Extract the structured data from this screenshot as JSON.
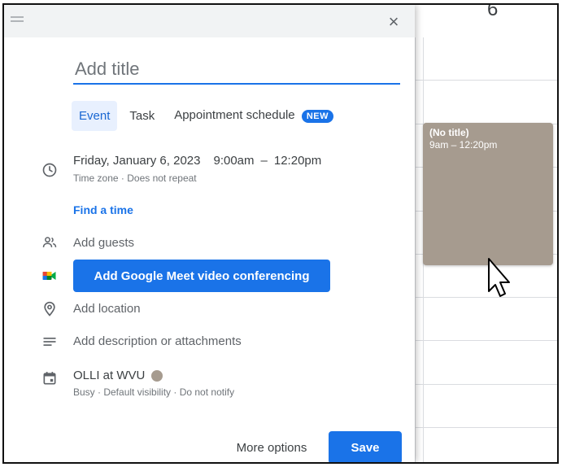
{
  "calendar": {
    "day_number": "6",
    "event_block": {
      "title": "(No title)",
      "time": "9am – 12:20pm",
      "color": "#a69b8f"
    }
  },
  "dialog": {
    "close_label": "×",
    "title_placeholder": "Add title",
    "tabs": [
      {
        "label": "Event",
        "active": true
      },
      {
        "label": "Task",
        "active": false
      },
      {
        "label": "Appointment schedule",
        "active": false,
        "badge": "NEW"
      }
    ],
    "datetime": {
      "date": "Friday, January 6, 2023",
      "start": "9:00am",
      "separator": "–",
      "end": "12:20pm",
      "subtext": "Time zone · Does not repeat"
    },
    "find_time_label": "Find a time",
    "add_guests_label": "Add guests",
    "meet_button_label": "Add Google Meet video conferencing",
    "add_location_label": "Add location",
    "add_description_label": "Add description or attachments",
    "calendar": {
      "name": "OLLI at WVU",
      "color": "#a69b8f",
      "subtext": "Busy · Default visibility · Do not notify"
    },
    "more_options_label": "More options",
    "save_label": "Save"
  },
  "colors": {
    "accent": "#1a73e8",
    "event": "#a69b8f"
  }
}
